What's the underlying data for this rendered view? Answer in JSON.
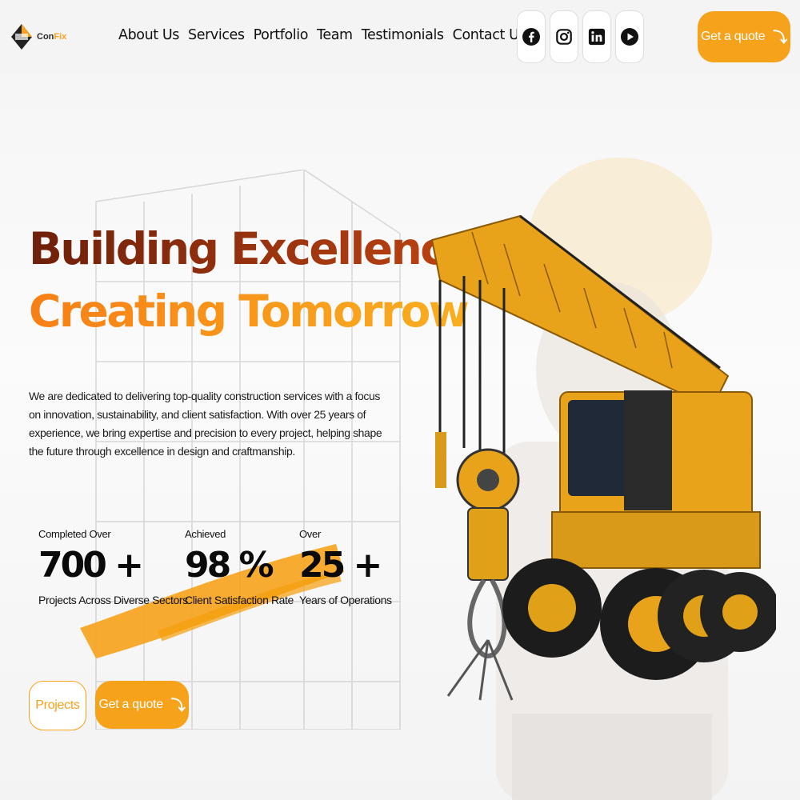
{
  "brand": {
    "name_part1": "Con",
    "name_part2": "Fix",
    "accent": "#f7a21b"
  },
  "nav": {
    "items": [
      "About Us",
      "Services",
      "Portfolio",
      "Team",
      "Testimonials",
      "Contact Us"
    ]
  },
  "socials": [
    {
      "icon": "facebook-icon"
    },
    {
      "icon": "instagram-icon"
    },
    {
      "icon": "linkedin-icon"
    },
    {
      "icon": "youtube-icon"
    }
  ],
  "header": {
    "quote_label": "Get a quote",
    "quote_arrow": "⤵"
  },
  "hero": {
    "headline_line1": "Building Excellence,",
    "headline_line2": "Creating Tomorrow",
    "description": "We are dedicated to delivering top-quality construction services with a focus on innovation, sustainability, and client satisfaction. With over 25 years of experience, we bring expertise and precision to every project, helping shape the future through excellence in design and craftmanship.",
    "stats": [
      {
        "pre": "Completed Over",
        "value": "700 +",
        "post": "Projects Across Diverse Sectors"
      },
      {
        "pre": "Achieved",
        "value": "98 %",
        "post": "Client Satisfaction Rate"
      },
      {
        "pre": "Over",
        "value": "25 +",
        "post": "Years of Operations"
      }
    ],
    "projects_label": "Projects",
    "quote_label": "Get a quote",
    "quote_arrow": "⤵"
  },
  "colors": {
    "headline_dark": "#8c2a0c",
    "headline_orange": "#f78b18",
    "button_orange": "#f7a21b"
  }
}
